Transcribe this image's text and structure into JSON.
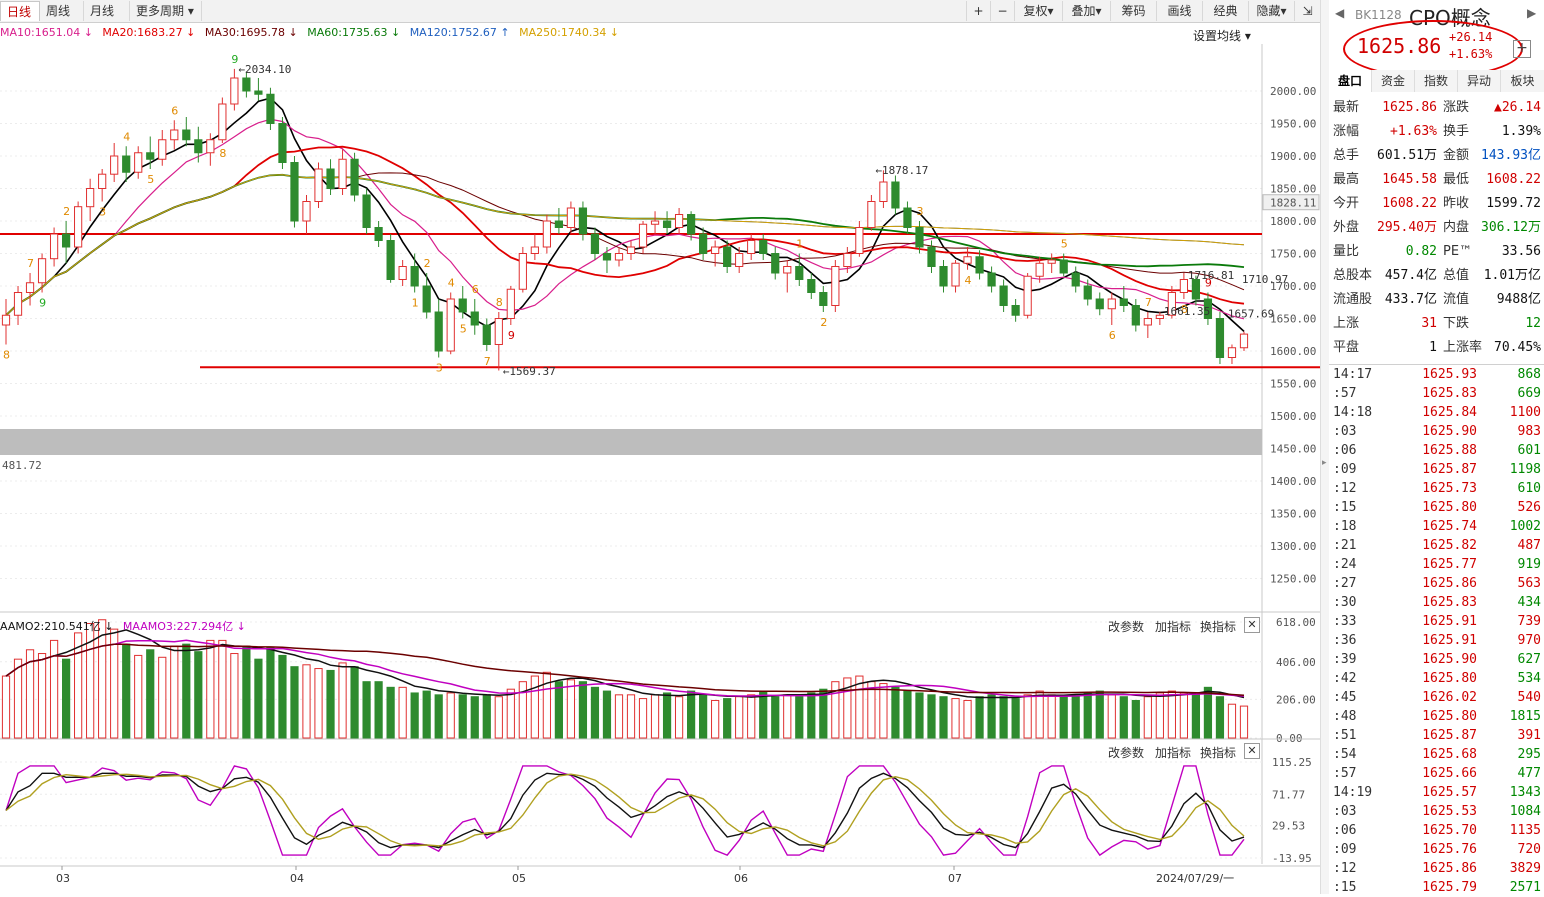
{
  "toolbar": {
    "period_tabs": [
      "日线",
      "周线",
      "月线",
      "更多周期"
    ],
    "buttons": [
      "+",
      "−",
      "复权",
      "叠加",
      "筹码",
      "画线",
      "经典",
      "隐藏"
    ]
  },
  "ma_legend": [
    {
      "label": "MA10:1651.04 ↓",
      "color": "#d81f8c"
    },
    {
      "label": "MA20:1683.27 ↓",
      "color": "#e00000"
    },
    {
      "label": "MA30:1695.78 ↓",
      "color": "#6b0000"
    },
    {
      "label": "MA60:1735.63 ↓",
      "color": "#0a7a0a"
    },
    {
      "label": "MA120:1752.67 ↑",
      "color": "#1f5fbf"
    },
    {
      "label": "MA250:1740.34 ↓",
      "color": "#d4a000"
    }
  ],
  "set_ma_label": "设置均线",
  "chart_data": {
    "type": "candlestick",
    "x_ticks": [
      "03",
      "04",
      "05",
      "06",
      "07",
      "2024/07/29/一"
    ],
    "y_ticks": [
      "2000.00",
      "1950.00",
      "1900.00",
      "1850.00",
      "1800.00",
      "1750.00",
      "1700.00",
      "1650.00",
      "1600.00",
      "1550.00",
      "1500.00",
      "1450.00",
      "1400.00",
      "1350.00",
      "1300.00",
      "1250.00"
    ],
    "price_tag": "1828.11",
    "price_annotations": [
      "2034.10",
      "1878.17",
      "1569.37",
      "1716.81",
      "1710.97",
      "1661.35",
      "1657.69",
      "481.72"
    ],
    "seq_labels": [
      {
        "t": "8",
        "c": "orange"
      },
      {
        "t": "7",
        "c": "orange"
      },
      {
        "t": "9",
        "c": "green"
      },
      {
        "t": "2",
        "c": "orange"
      },
      {
        "t": "3",
        "c": "orange"
      },
      {
        "t": "4",
        "c": "orange"
      },
      {
        "t": "5",
        "c": "orange"
      },
      {
        "t": "6",
        "c": "orange"
      },
      {
        "t": "8",
        "c": "orange"
      },
      {
        "t": "9",
        "c": "green"
      },
      {
        "t": "1",
        "c": "orange"
      },
      {
        "t": "2",
        "c": "orange"
      },
      {
        "t": "3",
        "c": "orange"
      },
      {
        "t": "4",
        "c": "orange"
      },
      {
        "t": "5",
        "c": "orange"
      },
      {
        "t": "6",
        "c": "orange"
      },
      {
        "t": "7",
        "c": "orange"
      },
      {
        "t": "8",
        "c": "orange"
      },
      {
        "t": "9",
        "c": "red"
      },
      {
        "t": "1",
        "c": "orange"
      },
      {
        "t": "2",
        "c": "orange"
      },
      {
        "t": "3",
        "c": "orange"
      },
      {
        "t": "4",
        "c": "orange"
      },
      {
        "t": "5",
        "c": "orange"
      },
      {
        "t": "6",
        "c": "orange"
      },
      {
        "t": "7",
        "c": "orange"
      },
      {
        "t": "8",
        "c": "orange"
      },
      {
        "t": "9",
        "c": "red"
      }
    ],
    "candles": [
      [
        1640,
        1680,
        1610,
        1655
      ],
      [
        1655,
        1700,
        1640,
        1690
      ],
      [
        1690,
        1720,
        1670,
        1705
      ],
      [
        1705,
        1750,
        1690,
        1742
      ],
      [
        1742,
        1790,
        1730,
        1780
      ],
      [
        1780,
        1800,
        1735,
        1760
      ],
      [
        1760,
        1830,
        1750,
        1822
      ],
      [
        1822,
        1865,
        1800,
        1850
      ],
      [
        1850,
        1880,
        1830,
        1872
      ],
      [
        1872,
        1920,
        1860,
        1900
      ],
      [
        1900,
        1915,
        1860,
        1875
      ],
      [
        1875,
        1915,
        1865,
        1905
      ],
      [
        1905,
        1930,
        1880,
        1895
      ],
      [
        1895,
        1940,
        1885,
        1925
      ],
      [
        1925,
        1955,
        1910,
        1940
      ],
      [
        1940,
        1960,
        1915,
        1925
      ],
      [
        1925,
        1945,
        1890,
        1905
      ],
      [
        1905,
        1935,
        1885,
        1925
      ],
      [
        1925,
        1990,
        1920,
        1980
      ],
      [
        1980,
        2034,
        1970,
        2020
      ],
      [
        2020,
        2030,
        1990,
        2000
      ],
      [
        2000,
        2020,
        1985,
        1995
      ],
      [
        1995,
        2005,
        1940,
        1950
      ],
      [
        1950,
        1960,
        1880,
        1890
      ],
      [
        1890,
        1900,
        1790,
        1800
      ],
      [
        1800,
        1840,
        1780,
        1830
      ],
      [
        1830,
        1890,
        1820,
        1880
      ],
      [
        1880,
        1895,
        1840,
        1850
      ],
      [
        1850,
        1910,
        1840,
        1895
      ],
      [
        1895,
        1905,
        1830,
        1840
      ],
      [
        1840,
        1850,
        1780,
        1790
      ],
      [
        1790,
        1800,
        1760,
        1770
      ],
      [
        1770,
        1780,
        1705,
        1710
      ],
      [
        1710,
        1740,
        1700,
        1730
      ],
      [
        1730,
        1750,
        1690,
        1700
      ],
      [
        1700,
        1720,
        1650,
        1660
      ],
      [
        1660,
        1680,
        1590,
        1600
      ],
      [
        1600,
        1690,
        1595,
        1680
      ],
      [
        1680,
        1700,
        1650,
        1660
      ],
      [
        1660,
        1680,
        1625,
        1640
      ],
      [
        1640,
        1650,
        1600,
        1610
      ],
      [
        1610,
        1660,
        1570,
        1650
      ],
      [
        1650,
        1700,
        1640,
        1695
      ],
      [
        1695,
        1760,
        1690,
        1750
      ],
      [
        1750,
        1780,
        1740,
        1760
      ],
      [
        1760,
        1810,
        1750,
        1800
      ],
      [
        1800,
        1820,
        1780,
        1790
      ],
      [
        1790,
        1830,
        1780,
        1820
      ],
      [
        1820,
        1830,
        1770,
        1780
      ],
      [
        1780,
        1790,
        1740,
        1750
      ],
      [
        1750,
        1760,
        1720,
        1740
      ],
      [
        1740,
        1760,
        1730,
        1750
      ],
      [
        1750,
        1770,
        1740,
        1760
      ],
      [
        1760,
        1800,
        1750,
        1795
      ],
      [
        1795,
        1815,
        1780,
        1800
      ],
      [
        1800,
        1815,
        1780,
        1790
      ],
      [
        1790,
        1820,
        1780,
        1810
      ],
      [
        1810,
        1815,
        1770,
        1780
      ],
      [
        1780,
        1790,
        1740,
        1750
      ],
      [
        1750,
        1770,
        1730,
        1760
      ],
      [
        1760,
        1770,
        1720,
        1730
      ],
      [
        1730,
        1760,
        1720,
        1750
      ],
      [
        1750,
        1780,
        1740,
        1770
      ],
      [
        1770,
        1780,
        1740,
        1750
      ],
      [
        1750,
        1760,
        1710,
        1720
      ],
      [
        1720,
        1740,
        1690,
        1730
      ],
      [
        1730,
        1750,
        1700,
        1710
      ],
      [
        1710,
        1720,
        1680,
        1690
      ],
      [
        1690,
        1700,
        1660,
        1670
      ],
      [
        1670,
        1740,
        1660,
        1730
      ],
      [
        1730,
        1760,
        1720,
        1750
      ],
      [
        1750,
        1800,
        1745,
        1790
      ],
      [
        1790,
        1840,
        1785,
        1830
      ],
      [
        1830,
        1878,
        1820,
        1860
      ],
      [
        1860,
        1870,
        1810,
        1820
      ],
      [
        1820,
        1830,
        1780,
        1790
      ],
      [
        1790,
        1800,
        1750,
        1760
      ],
      [
        1760,
        1770,
        1720,
        1730
      ],
      [
        1730,
        1740,
        1690,
        1700
      ],
      [
        1700,
        1740,
        1690,
        1735
      ],
      [
        1735,
        1760,
        1725,
        1745
      ],
      [
        1745,
        1755,
        1710,
        1720
      ],
      [
        1720,
        1730,
        1690,
        1700
      ],
      [
        1700,
        1710,
        1660,
        1670
      ],
      [
        1670,
        1680,
        1645,
        1655
      ],
      [
        1655,
        1720,
        1650,
        1715
      ],
      [
        1715,
        1745,
        1705,
        1735
      ],
      [
        1735,
        1750,
        1720,
        1740
      ],
      [
        1740,
        1750,
        1715,
        1720
      ],
      [
        1720,
        1730,
        1690,
        1700
      ],
      [
        1700,
        1710,
        1670,
        1680
      ],
      [
        1680,
        1690,
        1655,
        1665
      ],
      [
        1665,
        1690,
        1640,
        1680
      ],
      [
        1680,
        1700,
        1660,
        1670
      ],
      [
        1670,
        1680,
        1630,
        1640
      ],
      [
        1640,
        1660,
        1620,
        1650
      ],
      [
        1650,
        1660,
        1640,
        1655
      ],
      [
        1655,
        1700,
        1650,
        1690
      ],
      [
        1690,
        1720,
        1680,
        1710
      ],
      [
        1710,
        1716,
        1670,
        1680
      ],
      [
        1680,
        1690,
        1640,
        1650
      ],
      [
        1650,
        1660,
        1580,
        1590
      ],
      [
        1590,
        1610,
        1580,
        1605
      ],
      [
        1605,
        1630,
        1600,
        1626
      ]
    ],
    "vol_panel": {
      "legend": [
        {
          "label": "AAMO2:210.541亿 ↓",
          "color": "#111"
        },
        {
          "label": "MAAMO3:227.294亿 ↓",
          "color": "#c000c0"
        }
      ],
      "y_ticks": [
        "618.00",
        "406.00",
        "206.00",
        "0.00"
      ],
      "volumes": [
        330,
        420,
        470,
        450,
        520,
        420,
        560,
        610,
        630,
        580,
        500,
        440,
        470,
        430,
        490,
        500,
        460,
        520,
        520,
        450,
        490,
        420,
        480,
        440,
        380,
        390,
        370,
        360,
        400,
        380,
        300,
        300,
        270,
        270,
        240,
        250,
        230,
        240,
        230,
        220,
        230,
        220,
        260,
        300,
        330,
        350,
        300,
        310,
        300,
        270,
        250,
        230,
        230,
        210,
        230,
        240,
        220,
        250,
        230,
        200,
        210,
        220,
        230,
        250,
        220,
        230,
        220,
        240,
        260,
        300,
        320,
        330,
        300,
        290,
        270,
        250,
        240,
        230,
        220,
        210,
        200,
        220,
        230,
        220,
        210,
        230,
        250,
        230,
        220,
        230,
        240,
        250,
        230,
        220,
        200,
        220,
        240,
        250,
        240,
        240,
        270,
        220,
        180,
        170
      ]
    },
    "osc_panel": {
      "y_ticks": [
        "115.25",
        "71.77",
        "29.53",
        "-13.95"
      ]
    }
  },
  "panel_buttons": [
    "改参数",
    "加指标",
    "换指标"
  ],
  "quote": {
    "code": "BK1128",
    "name": "CPO概念",
    "price": "1625.86",
    "change": "+26.14",
    "change_pct": "+1.63%",
    "tabs": [
      "盘口",
      "资金",
      "指数",
      "异动",
      "板块"
    ],
    "rows": [
      {
        "k1": "最新",
        "v1": "1625.86",
        "c1": "red",
        "k2": "涨跌",
        "v2": "▲26.14",
        "c2": "red"
      },
      {
        "k1": "涨幅",
        "v1": "+1.63%",
        "c1": "red",
        "k2": "换手",
        "v2": "1.39%",
        "c2": "black"
      },
      {
        "k1": "总手",
        "v1": "601.51万",
        "c1": "black",
        "k2": "金额",
        "v2": "143.93亿",
        "c2": "blue"
      },
      {
        "k1": "最高",
        "v1": "1645.58",
        "c1": "red",
        "k2": "最低",
        "v2": "1608.22",
        "c2": "red"
      },
      {
        "k1": "今开",
        "v1": "1608.22",
        "c1": "red",
        "k2": "昨收",
        "v2": "1599.72",
        "c2": "black"
      },
      {
        "k1": "外盘",
        "v1": "295.40万",
        "c1": "red",
        "k2": "内盘",
        "v2": "306.12万",
        "c2": "green"
      },
      {
        "k1": "量比",
        "v1": "0.82",
        "c1": "green",
        "k2": "PE™",
        "v2": "33.56",
        "c2": "black"
      },
      {
        "k1": "总股本",
        "v1": "457.4亿",
        "c1": "black",
        "k2": "总值",
        "v2": "1.01万亿",
        "c2": "black"
      },
      {
        "k1": "流通股",
        "v1": "433.7亿",
        "c1": "black",
        "k2": "流值",
        "v2": "9488亿",
        "c2": "black"
      },
      {
        "k1": "上涨",
        "v1": "31",
        "c1": "red",
        "k2": "下跌",
        "v2": "12",
        "c2": "green"
      },
      {
        "k1": "平盘",
        "v1": "1",
        "c1": "black",
        "k2": "上涨率",
        "v2": "70.45%",
        "c2": "black"
      }
    ],
    "ticks": [
      {
        "t": "14:17",
        "p": "1625.93",
        "v": "868",
        "c": "green"
      },
      {
        "t": ":57",
        "p": "1625.83",
        "v": "669",
        "c": "green"
      },
      {
        "t": "14:18",
        "p": "1625.84",
        "v": "1100",
        "c": "red"
      },
      {
        "t": ":03",
        "p": "1625.90",
        "v": "983",
        "c": "red"
      },
      {
        "t": ":06",
        "p": "1625.88",
        "v": "601",
        "c": "green"
      },
      {
        "t": ":09",
        "p": "1625.87",
        "v": "1198",
        "c": "green"
      },
      {
        "t": ":12",
        "p": "1625.73",
        "v": "610",
        "c": "green"
      },
      {
        "t": ":15",
        "p": "1625.80",
        "v": "526",
        "c": "red"
      },
      {
        "t": ":18",
        "p": "1625.74",
        "v": "1002",
        "c": "green"
      },
      {
        "t": ":21",
        "p": "1625.82",
        "v": "487",
        "c": "red"
      },
      {
        "t": ":24",
        "p": "1625.77",
        "v": "919",
        "c": "green"
      },
      {
        "t": ":27",
        "p": "1625.86",
        "v": "563",
        "c": "red"
      },
      {
        "t": ":30",
        "p": "1625.83",
        "v": "434",
        "c": "green"
      },
      {
        "t": ":33",
        "p": "1625.91",
        "v": "739",
        "c": "red"
      },
      {
        "t": ":36",
        "p": "1625.91",
        "v": "970",
        "c": "red"
      },
      {
        "t": ":39",
        "p": "1625.90",
        "v": "627",
        "c": "green"
      },
      {
        "t": ":42",
        "p": "1625.80",
        "v": "534",
        "c": "green"
      },
      {
        "t": ":45",
        "p": "1626.02",
        "v": "540",
        "c": "red"
      },
      {
        "t": ":48",
        "p": "1625.80",
        "v": "1815",
        "c": "green"
      },
      {
        "t": ":51",
        "p": "1625.87",
        "v": "391",
        "c": "red"
      },
      {
        "t": ":54",
        "p": "1625.68",
        "v": "295",
        "c": "green"
      },
      {
        "t": ":57",
        "p": "1625.66",
        "v": "477",
        "c": "green"
      },
      {
        "t": "14:19",
        "p": "1625.57",
        "v": "1343",
        "c": "green"
      },
      {
        "t": ":03",
        "p": "1625.53",
        "v": "1084",
        "c": "green"
      },
      {
        "t": ":06",
        "p": "1625.70",
        "v": "1135",
        "c": "red"
      },
      {
        "t": ":09",
        "p": "1625.76",
        "v": "720",
        "c": "red"
      },
      {
        "t": ":12",
        "p": "1625.86",
        "v": "3829",
        "c": "red"
      },
      {
        "t": ":15",
        "p": "1625.79",
        "v": "2571",
        "c": "green"
      }
    ]
  }
}
